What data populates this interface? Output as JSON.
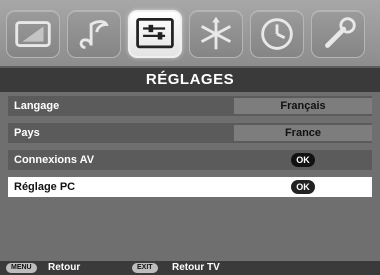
{
  "tabs": [
    {
      "name": "picture",
      "icon": "tv-icon",
      "active": false
    },
    {
      "name": "sound",
      "icon": "music-note-icon",
      "active": false
    },
    {
      "name": "settings",
      "icon": "settings-panel-icon",
      "active": true
    },
    {
      "name": "installation",
      "icon": "antenna-icon",
      "active": false
    },
    {
      "name": "timer",
      "icon": "clock-icon",
      "active": false
    },
    {
      "name": "tools",
      "icon": "wrench-icon",
      "active": false
    }
  ],
  "menu": {
    "title": "RÉGLAGES",
    "items": [
      {
        "label": "Langage",
        "value": "Français"
      },
      {
        "label": "Pays",
        "value": "France"
      },
      {
        "label": "Connexions AV",
        "ok": "OK"
      },
      {
        "label": "Réglage PC",
        "ok": "OK",
        "selected": true
      }
    ]
  },
  "footer": {
    "menu_key": "MENU",
    "menu_label": "Retour",
    "exit_key": "EXIT",
    "exit_label": "Retour TV"
  },
  "colors": {
    "background": "#6f6f6f",
    "title_bar": "#3a3a3a",
    "row": "#5b5b5b",
    "selected_row": "#ffffff",
    "value_box": "#7d7d7d"
  }
}
